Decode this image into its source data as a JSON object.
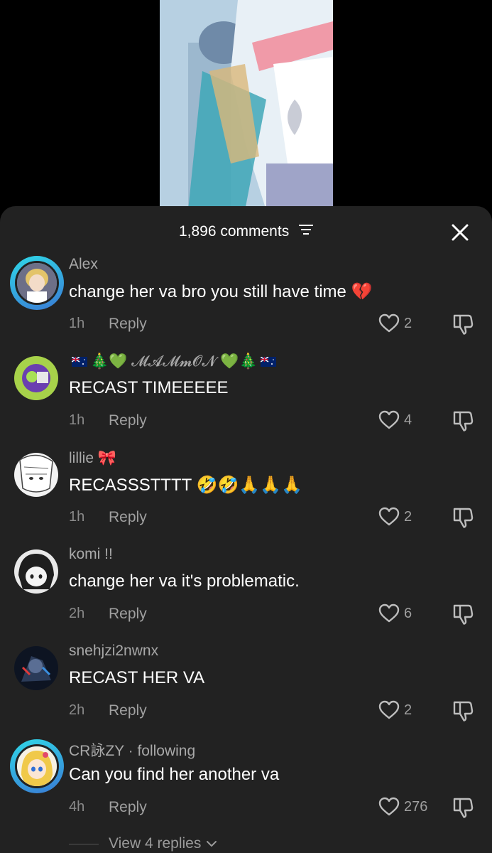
{
  "header": {
    "comment_count_label": "1,896 comments"
  },
  "comments": [
    {
      "username": "Alex",
      "text": "change her va bro you still have time",
      "emoji": "💔",
      "time": "1h",
      "reply_label": "Reply",
      "likes": "2",
      "avatar_ring": true
    },
    {
      "username_parts": [
        "🎄",
        "💚",
        "𝓜𝓐𝓜𝓶𝓞𝓝",
        "💚",
        "🎄"
      ],
      "text": "RECAST TIMEEEEE",
      "time": "1h",
      "reply_label": "Reply",
      "likes": "4",
      "avatar_ring": false
    },
    {
      "username": "lillie",
      "username_emoji": "🎀",
      "text": "RECASSSTTTT",
      "emoji": "🤣🤣🙏🙏🙏",
      "time": "1h",
      "reply_label": "Reply",
      "likes": "2",
      "avatar_ring": false
    },
    {
      "username": "komi !!",
      "text": "change her va it's problematic.",
      "time": "2h",
      "reply_label": "Reply",
      "likes": "6",
      "avatar_ring": false
    },
    {
      "username": "snehjzi2nwnx",
      "text": "RECAST HER VA",
      "time": "2h",
      "reply_label": "Reply",
      "likes": "2",
      "avatar_ring": false
    },
    {
      "username": "CR詠ZY · following",
      "text": "Can you find her another va",
      "time": "4h",
      "reply_label": "Reply",
      "likes": "276",
      "avatar_ring": true
    }
  ],
  "view_replies_label": "View 4 replies",
  "icons": {
    "filter": "filter-icon",
    "close": "close-icon",
    "like": "heart-icon",
    "dislike": "thumbs-down-icon",
    "chevron": "chevron-down-icon"
  }
}
